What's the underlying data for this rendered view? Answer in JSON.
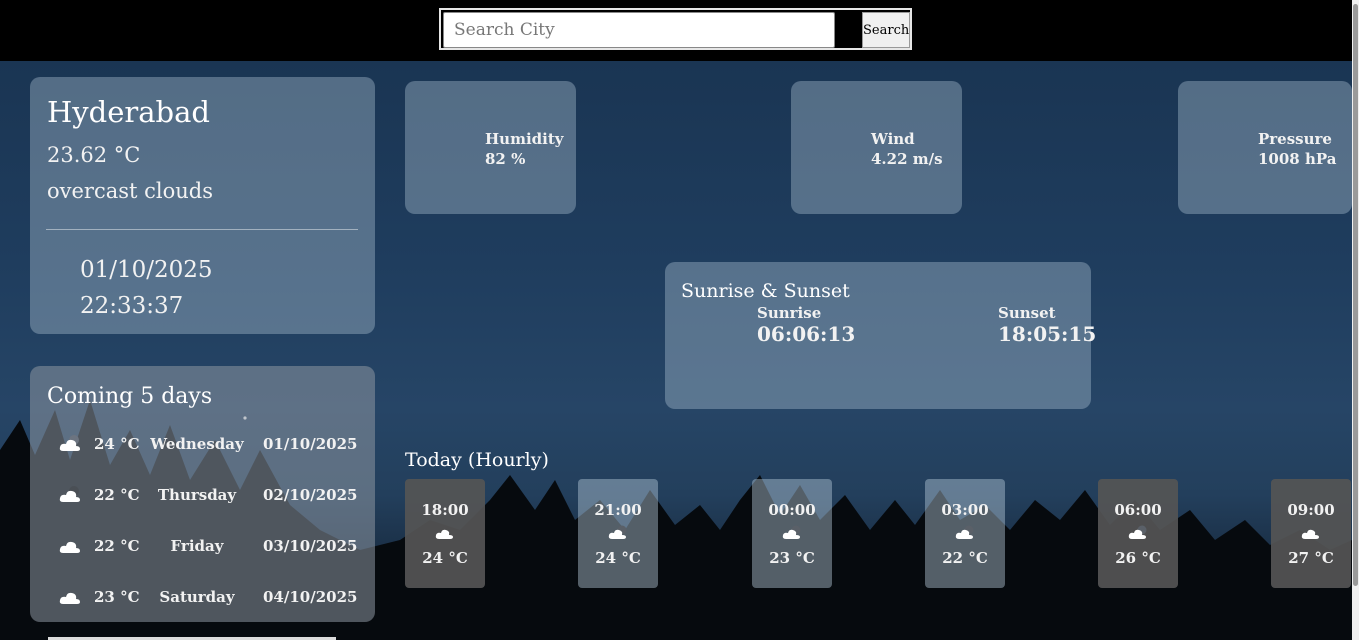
{
  "search": {
    "placeholder": "Search City",
    "button_label": "Search"
  },
  "current": {
    "city": "Hyderabad",
    "temperature": "23.62 °C",
    "description": "overcast clouds",
    "date": "01/10/2025",
    "time": "22:33:37"
  },
  "forecast": {
    "title": "Coming 5 days",
    "days": [
      {
        "icon": "cloud-night-icon",
        "temp": "24 °C",
        "day": "Wednesday",
        "date": "01/10/2025"
      },
      {
        "icon": "cloud-night-icon",
        "temp": "22 °C",
        "day": "Thursday",
        "date": "02/10/2025"
      },
      {
        "icon": "cloud-icon",
        "temp": "22 °C",
        "day": "Friday",
        "date": "03/10/2025"
      },
      {
        "icon": "cloud-icon",
        "temp": "23 °C",
        "day": "Saturday",
        "date": "04/10/2025"
      }
    ]
  },
  "stats": {
    "humidity": {
      "label": "Humidity",
      "value": "82 %"
    },
    "wind": {
      "label": "Wind",
      "value": "4.22 m/s"
    },
    "pressure": {
      "label": "Pressure",
      "value": "1008 hPa"
    }
  },
  "sun": {
    "title": "Sunrise & Sunset",
    "sunrise_label": "Sunrise",
    "sunrise_value": "06:06:13",
    "sunset_label": "Sunset",
    "sunset_value": "18:05:15"
  },
  "hourly": {
    "title": "Today (Hourly)",
    "items": [
      {
        "time": "18:00",
        "icon": "cloud-icon",
        "temp": "24 °C"
      },
      {
        "time": "21:00",
        "icon": "cloud-night-icon",
        "temp": "24 °C"
      },
      {
        "time": "00:00",
        "icon": "cloud-night-icon",
        "temp": "23 °C"
      },
      {
        "time": "03:00",
        "icon": "cloud-night-icon",
        "temp": "22 °C"
      },
      {
        "time": "06:00",
        "icon": "cloud-night-icon",
        "temp": "26 °C"
      },
      {
        "time": "09:00",
        "icon": "cloud-icon",
        "temp": "27 °C"
      }
    ]
  }
}
